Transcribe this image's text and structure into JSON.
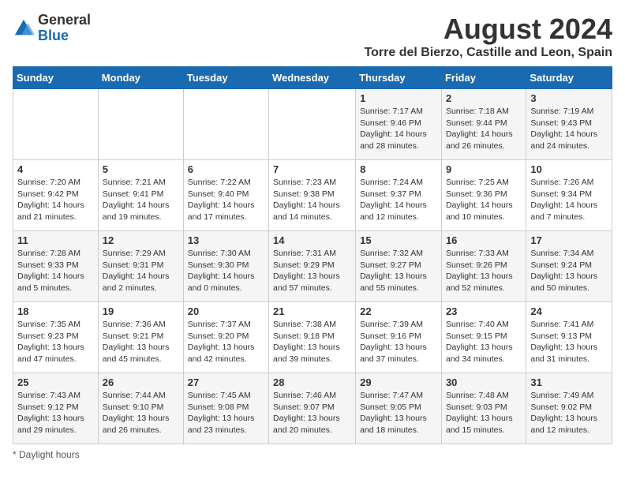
{
  "logo": {
    "general": "General",
    "blue": "Blue"
  },
  "title": "August 2024",
  "subtitle": "Torre del Bierzo, Castille and Leon, Spain",
  "days_of_week": [
    "Sunday",
    "Monday",
    "Tuesday",
    "Wednesday",
    "Thursday",
    "Friday",
    "Saturday"
  ],
  "weeks": [
    [
      {
        "num": "",
        "info": ""
      },
      {
        "num": "",
        "info": ""
      },
      {
        "num": "",
        "info": ""
      },
      {
        "num": "",
        "info": ""
      },
      {
        "num": "1",
        "info": "Sunrise: 7:17 AM\nSunset: 9:46 PM\nDaylight: 14 hours and 28 minutes."
      },
      {
        "num": "2",
        "info": "Sunrise: 7:18 AM\nSunset: 9:44 PM\nDaylight: 14 hours and 26 minutes."
      },
      {
        "num": "3",
        "info": "Sunrise: 7:19 AM\nSunset: 9:43 PM\nDaylight: 14 hours and 24 minutes."
      }
    ],
    [
      {
        "num": "4",
        "info": "Sunrise: 7:20 AM\nSunset: 9:42 PM\nDaylight: 14 hours and 21 minutes."
      },
      {
        "num": "5",
        "info": "Sunrise: 7:21 AM\nSunset: 9:41 PM\nDaylight: 14 hours and 19 minutes."
      },
      {
        "num": "6",
        "info": "Sunrise: 7:22 AM\nSunset: 9:40 PM\nDaylight: 14 hours and 17 minutes."
      },
      {
        "num": "7",
        "info": "Sunrise: 7:23 AM\nSunset: 9:38 PM\nDaylight: 14 hours and 14 minutes."
      },
      {
        "num": "8",
        "info": "Sunrise: 7:24 AM\nSunset: 9:37 PM\nDaylight: 14 hours and 12 minutes."
      },
      {
        "num": "9",
        "info": "Sunrise: 7:25 AM\nSunset: 9:36 PM\nDaylight: 14 hours and 10 minutes."
      },
      {
        "num": "10",
        "info": "Sunrise: 7:26 AM\nSunset: 9:34 PM\nDaylight: 14 hours and 7 minutes."
      }
    ],
    [
      {
        "num": "11",
        "info": "Sunrise: 7:28 AM\nSunset: 9:33 PM\nDaylight: 14 hours and 5 minutes."
      },
      {
        "num": "12",
        "info": "Sunrise: 7:29 AM\nSunset: 9:31 PM\nDaylight: 14 hours and 2 minutes."
      },
      {
        "num": "13",
        "info": "Sunrise: 7:30 AM\nSunset: 9:30 PM\nDaylight: 14 hours and 0 minutes."
      },
      {
        "num": "14",
        "info": "Sunrise: 7:31 AM\nSunset: 9:29 PM\nDaylight: 13 hours and 57 minutes."
      },
      {
        "num": "15",
        "info": "Sunrise: 7:32 AM\nSunset: 9:27 PM\nDaylight: 13 hours and 55 minutes."
      },
      {
        "num": "16",
        "info": "Sunrise: 7:33 AM\nSunset: 9:26 PM\nDaylight: 13 hours and 52 minutes."
      },
      {
        "num": "17",
        "info": "Sunrise: 7:34 AM\nSunset: 9:24 PM\nDaylight: 13 hours and 50 minutes."
      }
    ],
    [
      {
        "num": "18",
        "info": "Sunrise: 7:35 AM\nSunset: 9:23 PM\nDaylight: 13 hours and 47 minutes."
      },
      {
        "num": "19",
        "info": "Sunrise: 7:36 AM\nSunset: 9:21 PM\nDaylight: 13 hours and 45 minutes."
      },
      {
        "num": "20",
        "info": "Sunrise: 7:37 AM\nSunset: 9:20 PM\nDaylight: 13 hours and 42 minutes."
      },
      {
        "num": "21",
        "info": "Sunrise: 7:38 AM\nSunset: 9:18 PM\nDaylight: 13 hours and 39 minutes."
      },
      {
        "num": "22",
        "info": "Sunrise: 7:39 AM\nSunset: 9:16 PM\nDaylight: 13 hours and 37 minutes."
      },
      {
        "num": "23",
        "info": "Sunrise: 7:40 AM\nSunset: 9:15 PM\nDaylight: 13 hours and 34 minutes."
      },
      {
        "num": "24",
        "info": "Sunrise: 7:41 AM\nSunset: 9:13 PM\nDaylight: 13 hours and 31 minutes."
      }
    ],
    [
      {
        "num": "25",
        "info": "Sunrise: 7:43 AM\nSunset: 9:12 PM\nDaylight: 13 hours and 29 minutes."
      },
      {
        "num": "26",
        "info": "Sunrise: 7:44 AM\nSunset: 9:10 PM\nDaylight: 13 hours and 26 minutes."
      },
      {
        "num": "27",
        "info": "Sunrise: 7:45 AM\nSunset: 9:08 PM\nDaylight: 13 hours and 23 minutes."
      },
      {
        "num": "28",
        "info": "Sunrise: 7:46 AM\nSunset: 9:07 PM\nDaylight: 13 hours and 20 minutes."
      },
      {
        "num": "29",
        "info": "Sunrise: 7:47 AM\nSunset: 9:05 PM\nDaylight: 13 hours and 18 minutes."
      },
      {
        "num": "30",
        "info": "Sunrise: 7:48 AM\nSunset: 9:03 PM\nDaylight: 13 hours and 15 minutes."
      },
      {
        "num": "31",
        "info": "Sunrise: 7:49 AM\nSunset: 9:02 PM\nDaylight: 13 hours and 12 minutes."
      }
    ]
  ],
  "footer": "Daylight hours"
}
